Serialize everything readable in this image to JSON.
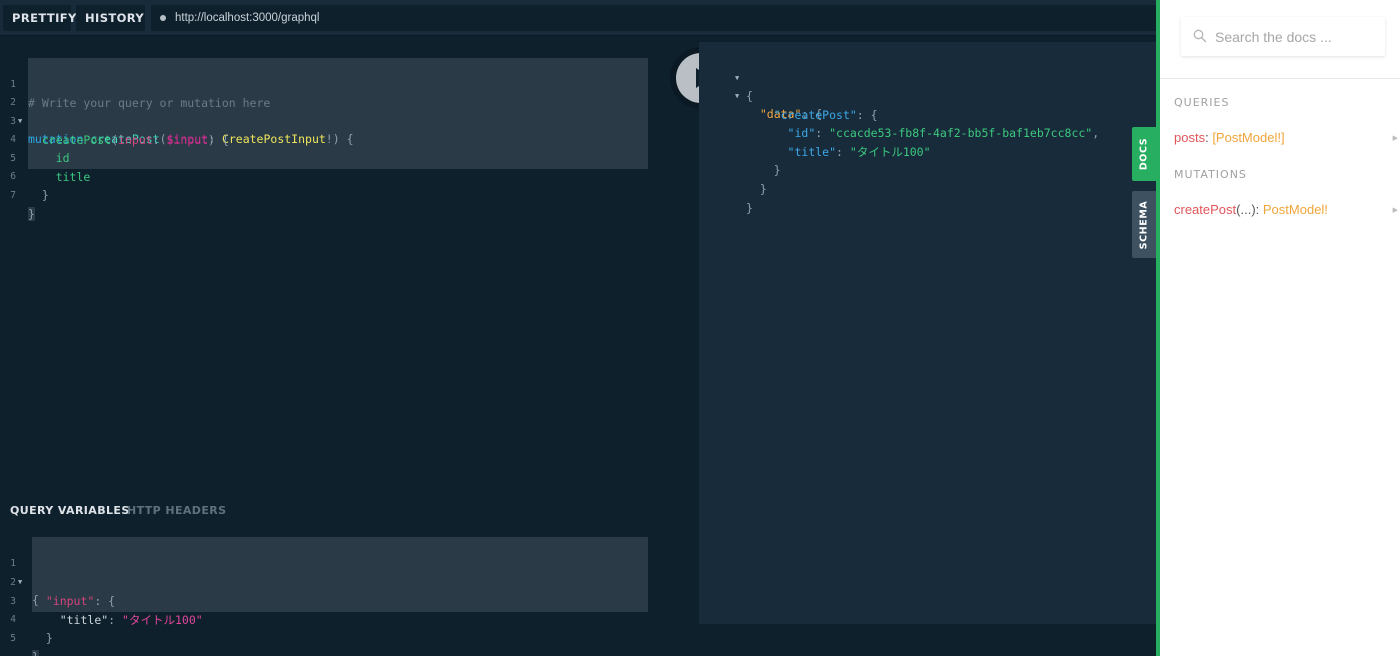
{
  "toolbar": {
    "prettify_label": "PRETTIFY",
    "history_label": "HISTORY",
    "url": "http://localhost:3000/graphql"
  },
  "editor": {
    "line_numbers": [
      "1",
      "2",
      "3",
      "4",
      "5",
      "6",
      "7"
    ],
    "comment": "# Write your query or mutation here",
    "kw_mutation": "mutation",
    "op_name": "createPost",
    "paren_open": "(",
    "var_name": "$input",
    "colon": ":",
    "type_name": "CreatePostInput",
    "bang_paren_brace": "!) {",
    "field_create": "createPost",
    "arg_name": "input",
    "arg_value": "$input",
    "paren_brace": ") {",
    "field_id": "id",
    "field_title": "title",
    "close_brace": "}"
  },
  "run_button": {
    "icon": "play-icon"
  },
  "variables": {
    "tab_active": "QUERY VARIABLES",
    "tab_inactive": "HTTP HEADERS",
    "line_numbers": [
      "1",
      "2",
      "3",
      "4",
      "5"
    ],
    "open_brace": "{",
    "key_input": "\"input\"",
    "key_title": "\"title\"",
    "value_title": "\"タイトル100\"",
    "colon_brace": ": {",
    "colon": ":",
    "close_brace": "}"
  },
  "results": {
    "open_brace": "{",
    "key_data": "\"data\"",
    "key_create": "\"createPost\"",
    "key_id": "\"id\"",
    "value_id": "\"ccacde53-fb8f-4af2-bb5f-baf1eb7cc8cc\"",
    "key_title": "\"title\"",
    "value_title": "\"タイトル100\"",
    "colon_brace": ": {",
    "colon": ":",
    "comma": ",",
    "close_brace": "}"
  },
  "side_tabs": {
    "docs": "DOCS",
    "schema": "SCHEMA"
  },
  "docs": {
    "search_placeholder": "Search the docs ...",
    "queries_title": "QUERIES",
    "query_field": "posts",
    "query_colon": ": ",
    "query_type": "[PostModel!]",
    "mutations_title": "MUTATIONS",
    "mutation_field": "createPost",
    "mutation_args": "(...)",
    "mutation_colon": ": ",
    "mutation_type": "PostModel!"
  },
  "colors": {
    "accent_green": "#27ae60",
    "editor_bg": "#0f202d",
    "result_bg": "#172b3a"
  }
}
